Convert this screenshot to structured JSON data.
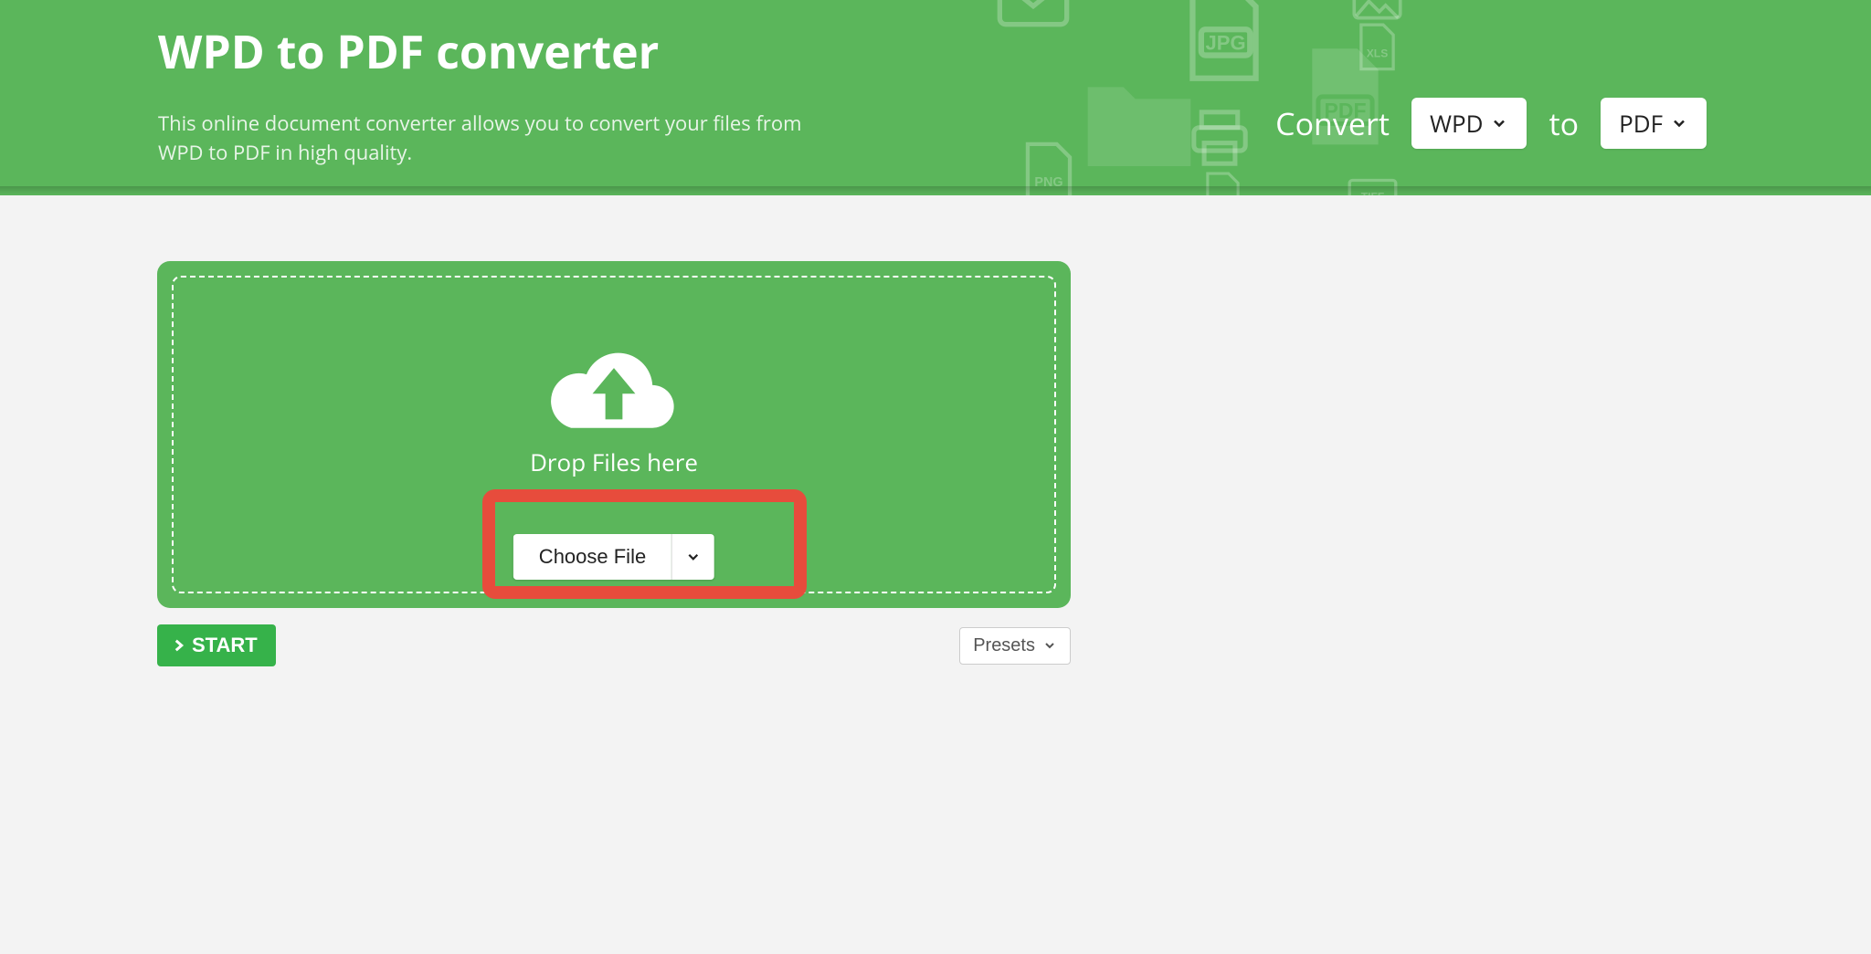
{
  "hero": {
    "title": "WPD to PDF converter",
    "subtitle": "This online document converter allows you to convert your files from WPD to PDF in high quality.",
    "convert_label": "Convert",
    "to_label": "to",
    "from_select": "WPD",
    "to_select": "PDF",
    "bg_icons": [
      "JPG",
      "PDF",
      "PNG",
      "XLS",
      "DOCX",
      "TIFF",
      "envelope",
      "image",
      "printer",
      "folder"
    ]
  },
  "dropzone": {
    "drop_label": "Drop Files here",
    "choose_file_label": "Choose File"
  },
  "actions": {
    "start_label": "START",
    "presets_label": "Presets"
  },
  "highlight": {
    "around": "choose-file-button",
    "color": "#e74c3c"
  }
}
